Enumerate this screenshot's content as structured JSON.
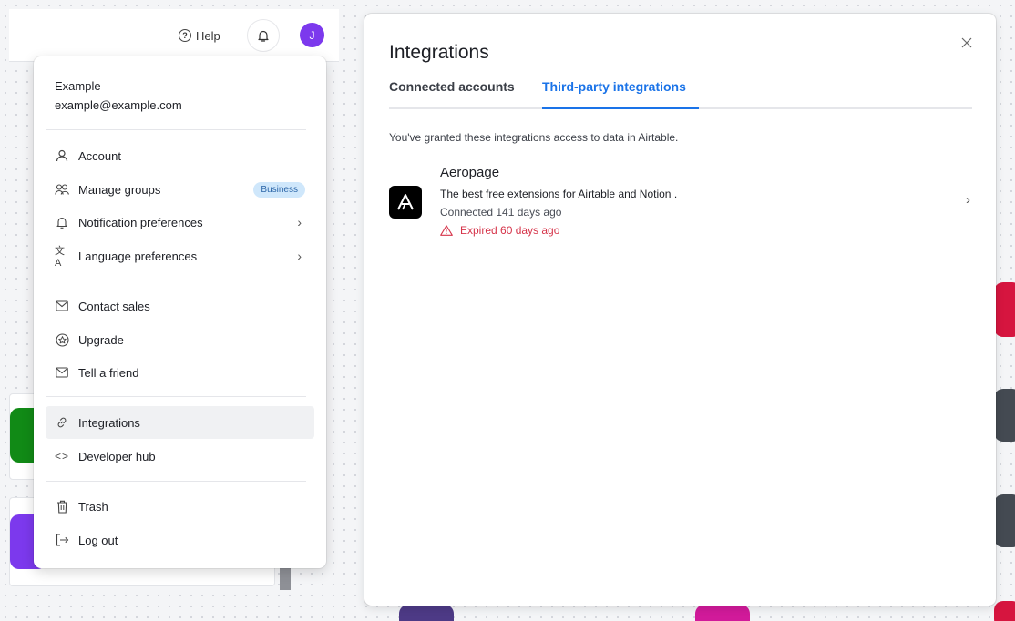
{
  "header": {
    "help_label": "Help",
    "avatar_initial": "J",
    "avatar_color": "#7c39ed"
  },
  "account_menu": {
    "user_name": "Example",
    "user_email": "example@example.com",
    "items": [
      {
        "label": "Account",
        "icon": "user-icon"
      },
      {
        "label": "Manage groups",
        "icon": "users-icon",
        "badge": "Business"
      },
      {
        "label": "Notification preferences",
        "icon": "bell-icon",
        "submenu": true
      },
      {
        "label": "Language preferences",
        "icon": "translate-icon",
        "submenu": true
      },
      {
        "label": "Contact sales",
        "icon": "envelope-icon"
      },
      {
        "label": "Upgrade",
        "icon": "upgrade-icon"
      },
      {
        "label": "Tell a friend",
        "icon": "envelope-icon"
      },
      {
        "label": "Integrations",
        "icon": "link-icon",
        "active": true
      },
      {
        "label": "Developer hub",
        "icon": "code-icon"
      },
      {
        "label": "Trash",
        "icon": "trash-icon"
      },
      {
        "label": "Log out",
        "icon": "logout-icon"
      }
    ]
  },
  "integrations_modal": {
    "title": "Integrations",
    "tabs": [
      {
        "label": "Connected accounts",
        "active": false
      },
      {
        "label": "Third-party integrations",
        "active": true
      }
    ],
    "grant_text": "You've granted these integrations access to data in Airtable.",
    "integrations": [
      {
        "name": "Aeropage",
        "description": "The best free extensions for Airtable and Notion .",
        "connected": "Connected 141 days ago",
        "expired": "Expired 60 days ago"
      }
    ]
  },
  "colors": {
    "accent": "#1a73e8",
    "error": "#d6344a",
    "badge_bg": "#cfe7fb"
  }
}
